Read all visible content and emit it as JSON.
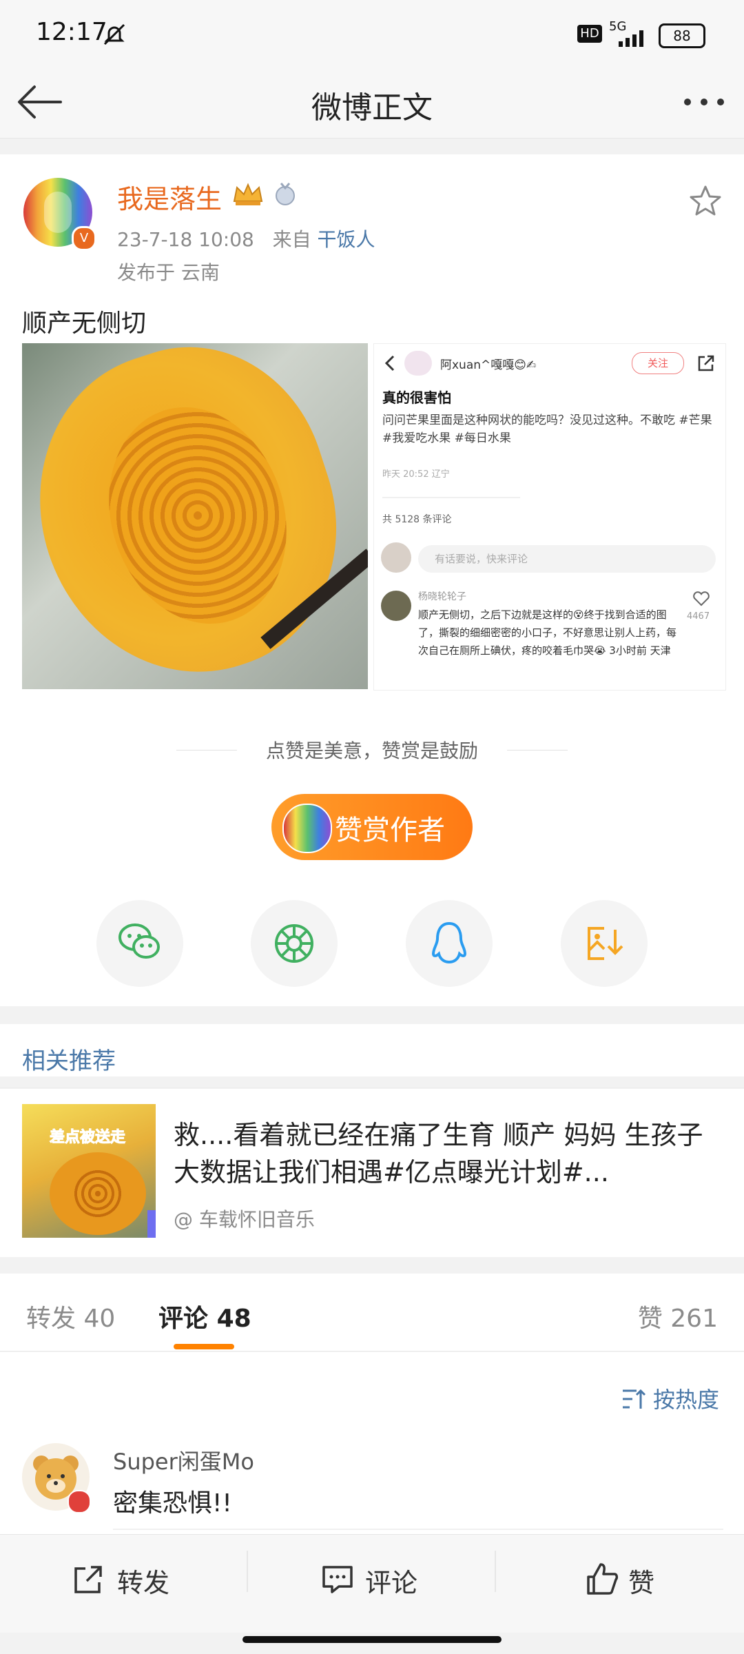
{
  "status_bar": {
    "time": "12:17",
    "battery": "88",
    "network": "5G",
    "hd": "HD"
  },
  "header": {
    "title": "微博正文"
  },
  "post": {
    "username": "我是落生",
    "timestamp": "23-7-18 10:08",
    "source_prefix": "来自",
    "source": "干饭人",
    "location": "发布于 云南",
    "text": "顺产无侧切"
  },
  "embedded_screenshot": {
    "user": "阿xuan^嘎嘎😊✍",
    "follow": "关注",
    "title": "真的很害怕",
    "body": "问问芒果里面是这种网状的能吃吗？没见过这种。不敢吃 #芒果  #我爱吃水果  #每日水果",
    "time": "昨天 20:52 辽宁",
    "comment_count": "共 5128 条评论",
    "input_placeholder": "有话要说，快来评论",
    "comment_user": "杨晓轮轮子",
    "comment_text": "顺产无侧切，之后下边就是这样的😵终于找到合适的图了，撕裂的细细密密的小口子，不好意思让别人上药，每次自己在厕所上碘伏，疼的咬着毛巾哭😭 3小时前 天津",
    "likes": "4467"
  },
  "reward": {
    "caption": "点赞是美意，赞赏是鼓励",
    "button": "赞赏作者"
  },
  "share_icons": [
    "wechat-icon",
    "moments-icon",
    "qq-icon",
    "save-image-icon"
  ],
  "related": {
    "section_title": "相关推荐",
    "thumb_caption": "差点被送走",
    "title": "救....看着就已经在痛了生育 顺产  妈妈 生孩子 大数据让我们相遇#亿点曝光计划#...",
    "author": "@ 车载怀旧音乐"
  },
  "tabs": {
    "repost_label": "转发",
    "repost_count": "40",
    "comment_label": "评论",
    "comment_count": "48",
    "like_label": "赞",
    "like_count": "261"
  },
  "sort_label": "按热度",
  "comment": {
    "username": "Super闲蛋Mo",
    "text": "密集恐惧!!"
  },
  "bottom_bar": {
    "repost": "转发",
    "comment": "评论",
    "like": "赞"
  },
  "colors": {
    "accent": "#ff8200",
    "link": "#4a78a8",
    "username": "#e8691f"
  }
}
